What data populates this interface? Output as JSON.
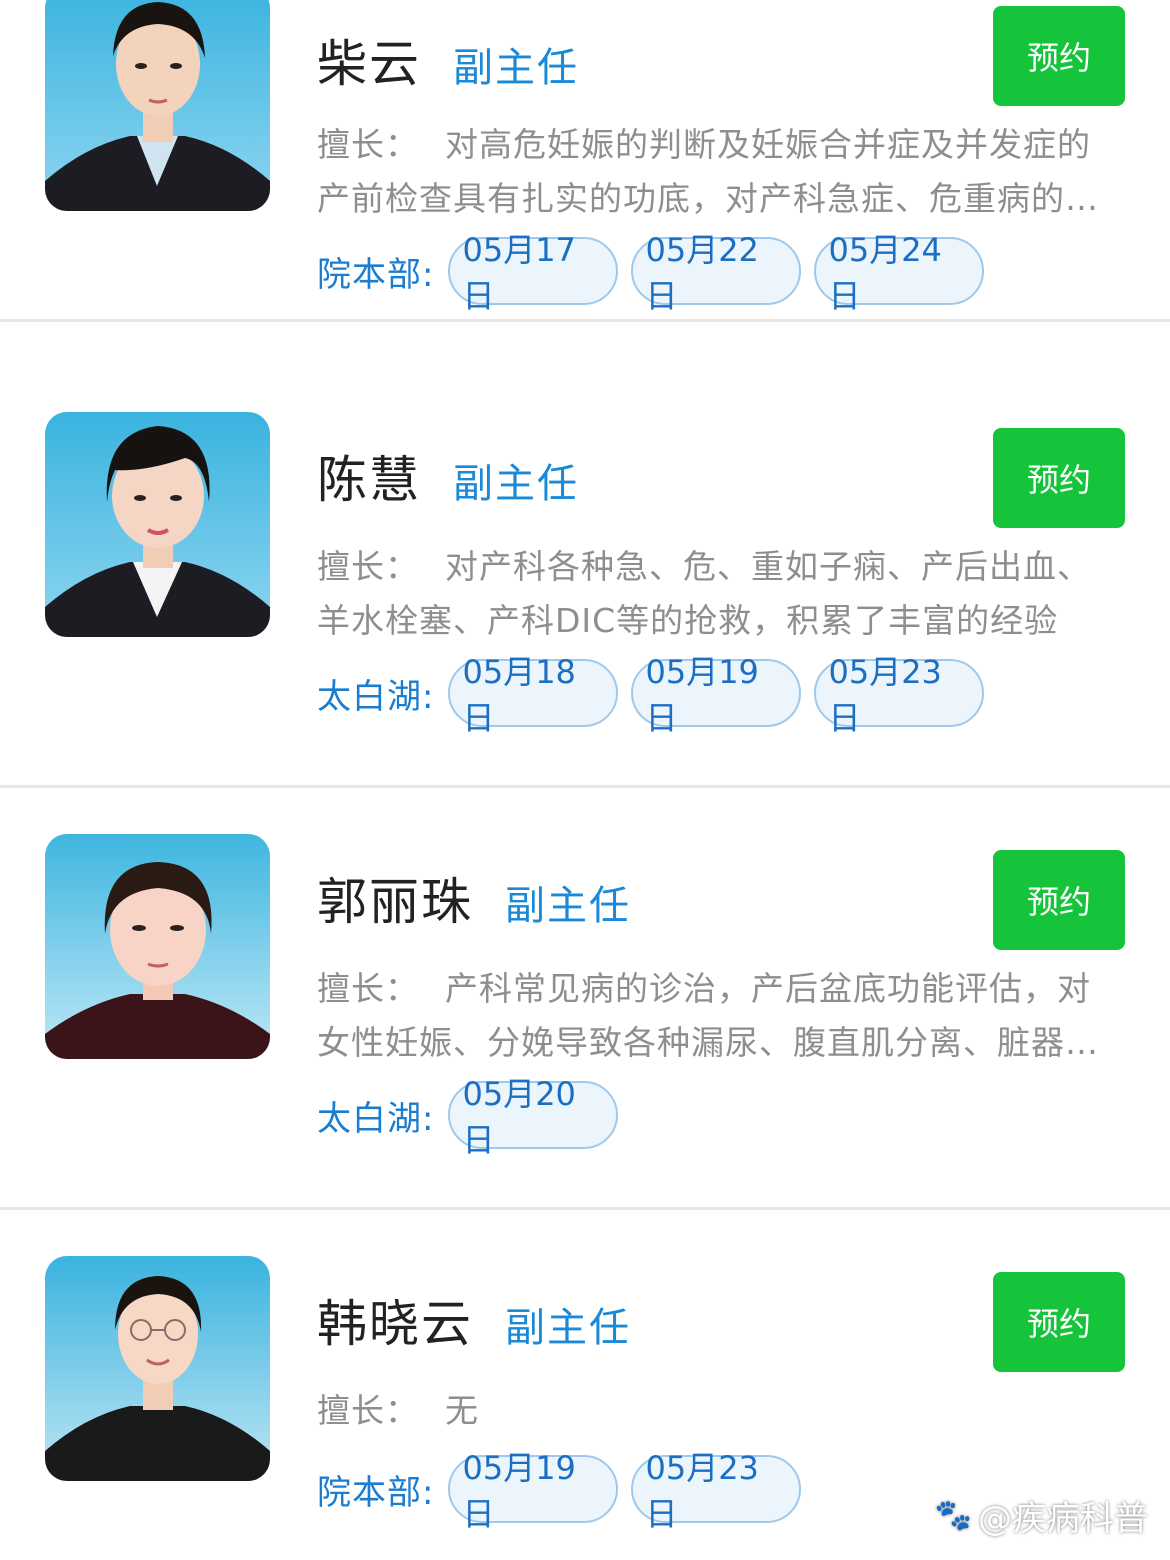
{
  "colors": {
    "accent": "#1a8ad8",
    "button_green": "#16c43c",
    "pill_border": "#9ec9ec",
    "pill_bg": "#edf5fc",
    "text_gray": "#8e8e8e",
    "divider": "#e6e6e6"
  },
  "doctors": [
    {
      "name": "柴云",
      "title": "副主任",
      "book_label": "预约",
      "specialty_label": "擅长：",
      "specialty": "对高危妊娠的判断及妊娠合并症及并发症的产前检查具有扎实的功底，对产科急症、危重病的诊治有丰富经验",
      "location": "院本部:",
      "dates": [
        "05月17日",
        "05月22日",
        "05月24日"
      ]
    },
    {
      "name": "陈慧",
      "title": "副主任",
      "book_label": "预约",
      "specialty_label": "擅长：",
      "specialty": "对产科各种急、危、重如子痫、产后出血、羊水栓塞、产科DIC等的抢救，积累了丰富的经验",
      "location": "太白湖:",
      "dates": [
        "05月18日",
        "05月19日",
        "05月23日"
      ]
    },
    {
      "name": "郭丽珠",
      "title": "副主任",
      "book_label": "预约",
      "specialty_label": "擅长：",
      "specialty": "产科常见病的诊治，产后盆底功能评估，对女性妊娠、分娩导致各种漏尿、腹直肌分离、脏器脱垂等的诊治",
      "location": "太白湖:",
      "dates": [
        "05月20日"
      ]
    },
    {
      "name": "韩晓云",
      "title": "副主任",
      "book_label": "预约",
      "specialty_label": "擅长：",
      "specialty": "无",
      "location": "院本部:",
      "dates": [
        "05月19日",
        "05月23日"
      ]
    }
  ],
  "watermark": {
    "icon": "paw-icon",
    "text": "@疾病科普"
  }
}
